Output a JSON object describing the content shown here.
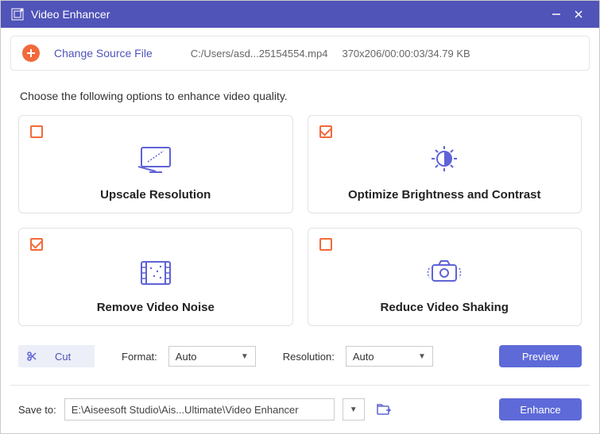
{
  "titlebar": {
    "title": "Video Enhancer"
  },
  "source": {
    "change_label": "Change Source File",
    "file_path": "C:/Users/asd...25154554.mp4",
    "file_meta": "370x206/00:00:03/34.79 KB"
  },
  "instruction": "Choose the following options to enhance video quality.",
  "options": {
    "upscale": {
      "title": "Upscale Resolution",
      "checked": false
    },
    "brightness": {
      "title": "Optimize Brightness and Contrast",
      "checked": true
    },
    "noise": {
      "title": "Remove Video Noise",
      "checked": true
    },
    "shaking": {
      "title": "Reduce Video Shaking",
      "checked": false
    }
  },
  "controls": {
    "cut_label": "Cut",
    "format_label": "Format:",
    "format_value": "Auto",
    "resolution_label": "Resolution:",
    "resolution_value": "Auto",
    "preview_label": "Preview"
  },
  "save": {
    "label": "Save to:",
    "path": "E:\\Aiseesoft Studio\\Ais...Ultimate\\Video Enhancer",
    "enhance_label": "Enhance"
  }
}
